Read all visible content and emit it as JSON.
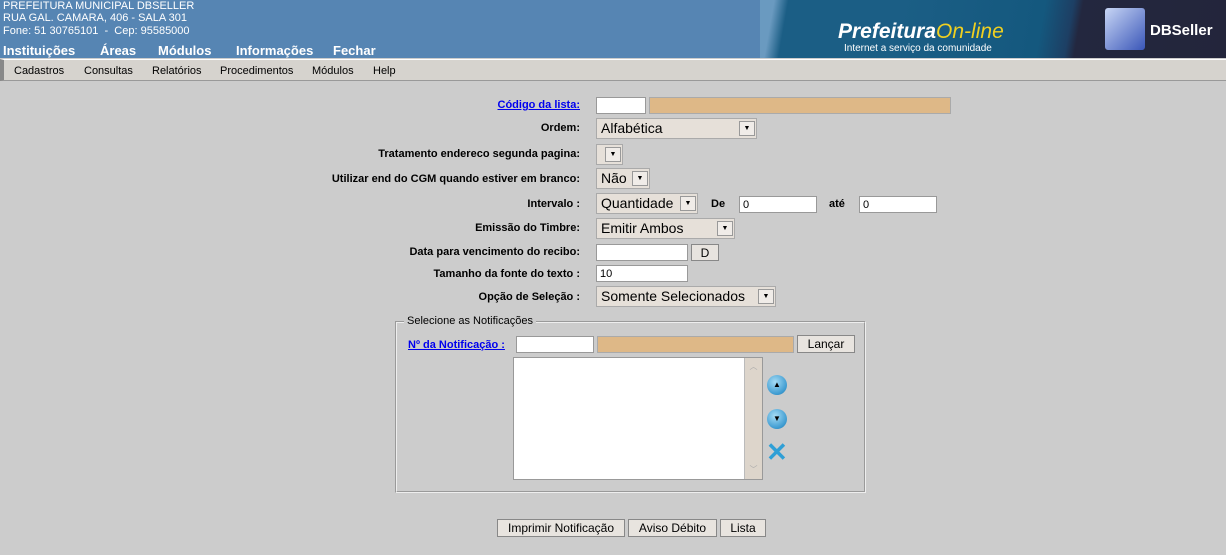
{
  "header": {
    "org": "PREFEITURA MUNICIPAL DBSELLER",
    "address": "RUA GAL. CAMARA, 406 - SALA 301",
    "contact": "Fone: 51 30765101  -  Cep: 95585000",
    "logo_title": "Prefeitura",
    "logo_title2": "On-line",
    "logo_sub": "Internet a serviço da comunidade",
    "brand": "DBSeller"
  },
  "top_menu": [
    "Instituições",
    "Áreas",
    "Módulos",
    "Informações",
    "Fechar"
  ],
  "sub_menu": [
    "Cadastros",
    "Consultas",
    "Relatórios",
    "Procedimentos",
    "Módulos",
    "Help"
  ],
  "form": {
    "codigo_label": "Código da lista:",
    "codigo_value": "",
    "ordem_label": "Ordem:",
    "ordem_value": "Alfabética",
    "tratamento_label": "Tratamento endereco segunda pagina:",
    "tratamento_value": "",
    "utilizar_label": "Utilizar end do CGM quando estiver em branco:",
    "utilizar_value": "Não",
    "intervalo_label": "Intervalo :",
    "intervalo_value": "Quantidade",
    "de_label": "De",
    "de_value": "0",
    "ate_label": "até",
    "ate_value": "0",
    "timbre_label": "Emissão do Timbre:",
    "timbre_value": "Emitir Ambos",
    "data_label": "Data para vencimento do recibo:",
    "data_value": "",
    "data_button": "D",
    "fonte_label": "Tamanho da fonte do texto :",
    "fonte_value": "10",
    "opcao_label": "Opção de Seleção :",
    "opcao_value": "Somente Selecionados"
  },
  "fieldset": {
    "legend": "Selecione as Notificações",
    "notif_label": "Nº da Notificação :",
    "notif_value": "",
    "lancar": "Lançar"
  },
  "buttons": {
    "imprimir": "Imprimir Notificação",
    "aviso": "Aviso Débito",
    "lista": "Lista"
  },
  "colors": {
    "header": "#5685b3",
    "readonly": "#deb887",
    "bg": "#cccccc"
  }
}
